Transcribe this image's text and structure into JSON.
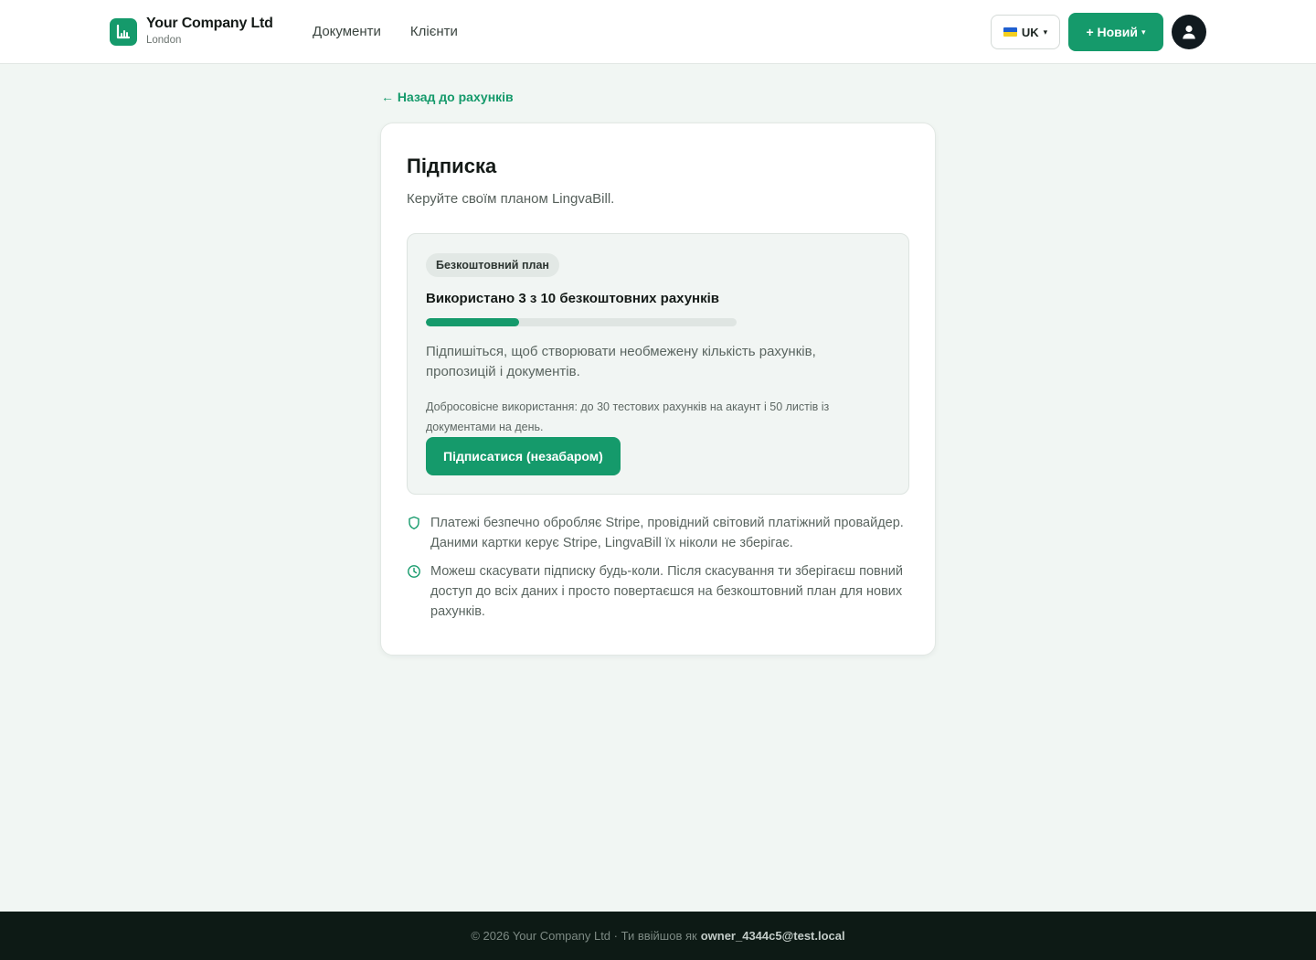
{
  "header": {
    "company_name": "Your Company Ltd",
    "company_city": "London",
    "nav": [
      {
        "label": "Документи"
      },
      {
        "label": "Клієнти"
      }
    ],
    "language_label": "UK",
    "language_caret": "▾",
    "new_button_label": "+ Новий",
    "new_button_caret": "▾"
  },
  "back_link": "← Назад до рахунків",
  "subscription": {
    "title": "Підписка",
    "subtitle": "Керуйте своїм планом LingvaBill.",
    "plan_badge": "Безкоштовний план",
    "usage_text": "Використано 3 з 10 безкоштовних рахунків",
    "usage_used": 3,
    "usage_limit": 10,
    "description": "Підпишіться, щоб створювати необмежену кількість рахунків, пропозицій і документів.",
    "fair_use": "Добросовісне використання: до 30 тестових рахунків на акаунт і 50 листів із документами на день.",
    "subscribe_button": "Підписатися (незабаром)",
    "info": [
      {
        "icon": "shield-icon",
        "text": "Платежі безпечно обробляє Stripe, провідний світовий платіжний провайдер. Даними картки керує Stripe, LingvaBill їх ніколи не зберігає."
      },
      {
        "icon": "clock-icon",
        "text": "Можеш скасувати підписку будь-коли. Після скасування ти зберігаєш повний доступ до всіх даних і просто повертаєшся на безкоштовний план для нових рахунків."
      }
    ]
  },
  "footer": {
    "prefix": "© 2026 Your Company Ltd · Ти ввійшов як",
    "email": "owner_4344c5@test.local"
  },
  "colors": {
    "accent": "#159a6b",
    "background": "#f1f6f3",
    "footer_bg": "#0d1a15",
    "avatar_bg": "#111a1f"
  }
}
